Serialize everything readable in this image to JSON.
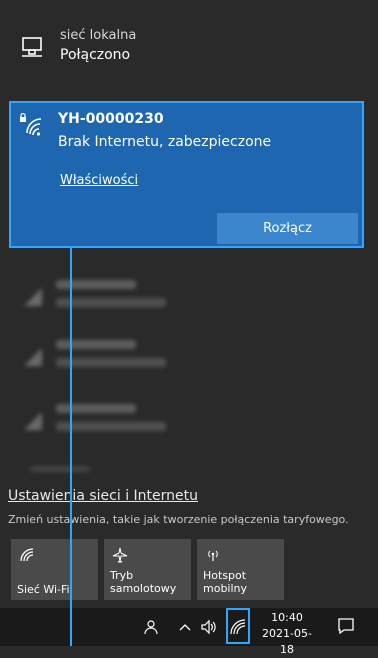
{
  "ethernet": {
    "name": "sieć lokalna",
    "status": "Połączono"
  },
  "selected_network": {
    "ssid": "YH-00000230",
    "status": "Brak Internetu, zabezpieczone",
    "properties_label": "Właściwości",
    "disconnect_label": "Rozłącz"
  },
  "settings": {
    "link": "Ustawienia sieci i Internetu",
    "description": "Zmień ustawienia, takie jak tworzenie połączenia taryfowego."
  },
  "quick_actions": [
    {
      "label": "Sieć Wi-Fi",
      "icon": "wifi-icon"
    },
    {
      "label_line1": "Tryb",
      "label_line2": "samolotowy",
      "icon": "airplane-icon"
    },
    {
      "label_line1": "Hotspot",
      "label_line2": "mobilny",
      "icon": "hotspot-icon"
    }
  ],
  "taskbar": {
    "time": "10:40",
    "date": "2021-05-18"
  },
  "colors": {
    "accent": "#1f66b0",
    "highlight": "#2fa6ff",
    "tile": "#4a4a4a",
    "background": "#2a2a2a"
  }
}
